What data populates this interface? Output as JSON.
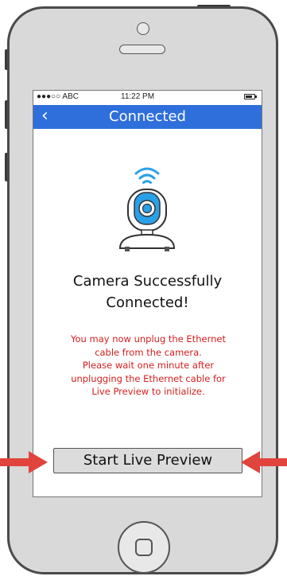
{
  "status_bar": {
    "carrier": "●●●○○ ABC",
    "time": "11:22 PM",
    "battery_icon": "battery-icon"
  },
  "nav": {
    "back_icon": "‹",
    "title": "Connected"
  },
  "illustration": {
    "icon": "camera-wifi-icon",
    "accent_color": "#2aa0e8"
  },
  "headline": {
    "line1": "Camera Successfully",
    "line2": "Connected!"
  },
  "notice": {
    "color": "#d62020",
    "line1": "You may now unplug the Ethernet",
    "line2": "cable from the camera.",
    "line3": "Please wait one minute after",
    "line4": "unplugging the Ethernet cable for",
    "line5": "Live Preview to initialize."
  },
  "actions": {
    "start_label": "Start Live Preview"
  },
  "annotations": {
    "arrow_color": "#e0443c"
  },
  "colors": {
    "nav_bar": "#2f6fdc",
    "phone_body": "#d9d9d9"
  }
}
